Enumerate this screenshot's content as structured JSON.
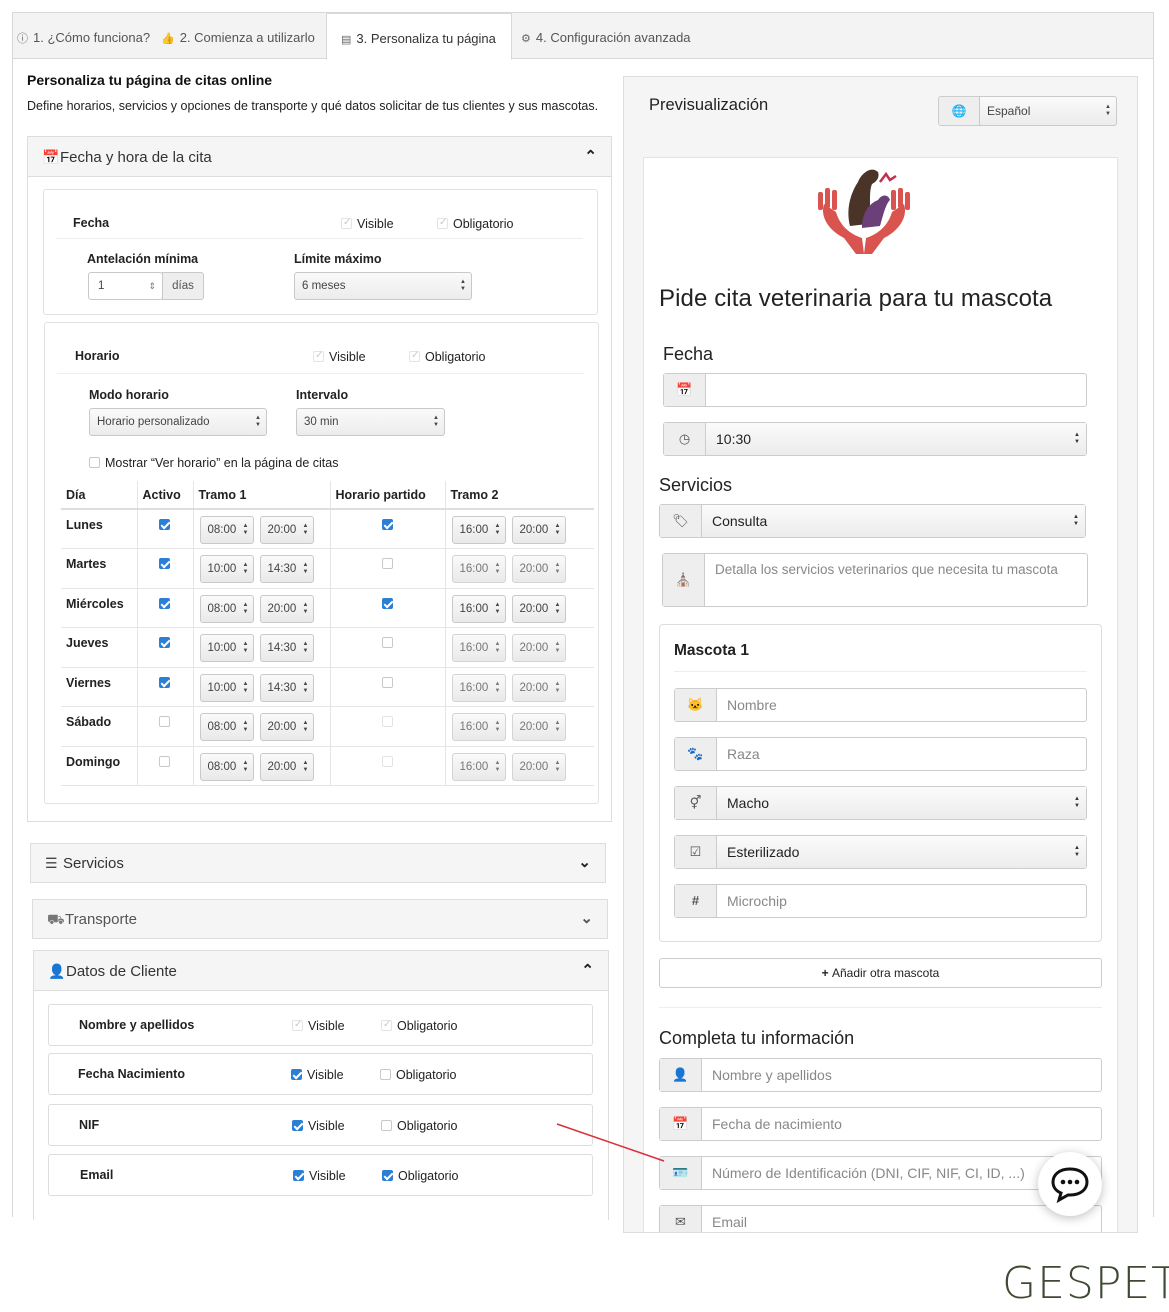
{
  "tabs": [
    {
      "label": "1. ¿Cómo funciona?",
      "icon": "info-icon"
    },
    {
      "label": "2. Comienza a utilizarlo",
      "icon": "thumbs-up-icon"
    },
    {
      "label": "3. Personaliza tu página",
      "icon": "page-icon",
      "active": true
    },
    {
      "label": "4. Configuración avanzada",
      "icon": "gears-icon"
    }
  ],
  "intro": {
    "title": "Personaliza tu página de citas online",
    "description": "Define horarios, servicios y opciones de transporte y qué datos solicitar de tus clientes y sus mascotas."
  },
  "fecha_panel": {
    "title": "Fecha y hora de la cita",
    "fecha": {
      "label": "Fecha",
      "visible": "Visible",
      "obligatorio": "Obligatorio"
    },
    "antelacion": {
      "label": "Antelación mínima",
      "value": "1",
      "unit": "días"
    },
    "limite": {
      "label": "Límite máximo",
      "value": "6 meses"
    },
    "horario": {
      "label": "Horario",
      "visible": "Visible",
      "obligatorio": "Obligatorio"
    },
    "modo": {
      "label": "Modo horario",
      "value": "Horario personalizado"
    },
    "intervalo": {
      "label": "Intervalo",
      "value": "30 min"
    },
    "mostrar": "Mostrar “Ver horario” en la página de citas",
    "table_headers": [
      "Día",
      "Activo",
      "Tramo 1",
      "Horario partido",
      "Tramo 2"
    ],
    "rows": [
      {
        "day": "Lunes",
        "active": true,
        "t1a": "08:00",
        "t1b": "20:00",
        "split": true,
        "t2a": "16:00",
        "t2b": "20:00"
      },
      {
        "day": "Martes",
        "active": true,
        "t1a": "10:00",
        "t1b": "14:30",
        "split": false,
        "t2a": "16:00",
        "t2b": "20:00"
      },
      {
        "day": "Miércoles",
        "active": true,
        "t1a": "08:00",
        "t1b": "20:00",
        "split": true,
        "t2a": "16:00",
        "t2b": "20:00"
      },
      {
        "day": "Jueves",
        "active": true,
        "t1a": "10:00",
        "t1b": "14:30",
        "split": false,
        "t2a": "16:00",
        "t2b": "20:00"
      },
      {
        "day": "Viernes",
        "active": true,
        "t1a": "10:00",
        "t1b": "14:30",
        "split": false,
        "t2a": "16:00",
        "t2b": "20:00"
      },
      {
        "day": "Sábado",
        "active": false,
        "t1a": "08:00",
        "t1b": "20:00",
        "split": false,
        "t2a": "16:00",
        "t2b": "20:00"
      },
      {
        "day": "Domingo",
        "active": false,
        "t1a": "08:00",
        "t1b": "20:00",
        "split": false,
        "t2a": "16:00",
        "t2b": "20:00"
      }
    ]
  },
  "servicios_panel": {
    "title": "Servicios"
  },
  "transporte_panel": {
    "title": "Transporte"
  },
  "cliente_panel": {
    "title": "Datos de Cliente",
    "rows": [
      {
        "label": "Nombre y apellidos",
        "visible": "Visible",
        "obligatorio": "Obligatorio"
      },
      {
        "label": "Fecha Nacimiento",
        "visible": "Visible",
        "obligatorio": "Obligatorio"
      },
      {
        "label": "NIF",
        "visible": "Visible",
        "obligatorio": "Obligatorio"
      },
      {
        "label": "Email",
        "visible": "Visible",
        "obligatorio": "Obligatorio"
      }
    ]
  },
  "preview": {
    "title": "Previsualización",
    "language": "Español",
    "heading": "Pide cita veterinaria para tu mascota",
    "fecha_label": "Fecha",
    "time_value": "10:30",
    "servicios_label": "Servicios",
    "servicio_value": "Consulta",
    "servicio_detail_placeholder": "Detalla los servicios veterinarios que necesita tu mascota",
    "mascota_title": "Mascota 1",
    "mascota_fields": {
      "nombre": "Nombre",
      "raza": "Raza",
      "sexo": "Macho",
      "esterilizado": "Esterilizado",
      "microchip": "Microchip"
    },
    "add_pet": "Añadir otra mascota",
    "info_title": "Completa tu información",
    "info_fields": {
      "nombre": "Nombre y apellidos",
      "nacimiento": "Fecha de nacimiento",
      "id": "Número de Identificación (DNI, CIF, NIF, CI, ID, ...)",
      "email": "Email"
    }
  },
  "brand": "GESPET",
  "colors": {
    "accent": "#2b7fd4",
    "annotation_arrow": "#d9303a",
    "brand": "#3f4a34"
  }
}
